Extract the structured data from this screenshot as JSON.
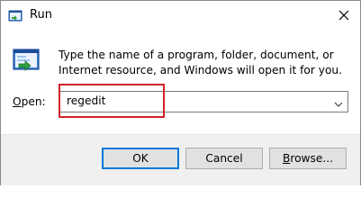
{
  "window": {
    "title": "Run",
    "close_glyph": "✕"
  },
  "icons": {
    "title_icon": "run-icon",
    "big_icon": "run-icon",
    "close_icon": "close-icon",
    "dropdown_icon": "chevron-down-icon"
  },
  "dialog": {
    "description": "Type the name of a program, folder, document, or Internet resource, and Windows will open it for you.",
    "open_label_accel": "O",
    "open_label_rest": "pen:",
    "input_value": "regedit"
  },
  "buttons": {
    "ok": "OK",
    "cancel": "Cancel",
    "browse_accel": "B",
    "browse_rest": "rowse..."
  },
  "colors": {
    "highlight": "#d0232a",
    "accent": "#0078d7"
  }
}
